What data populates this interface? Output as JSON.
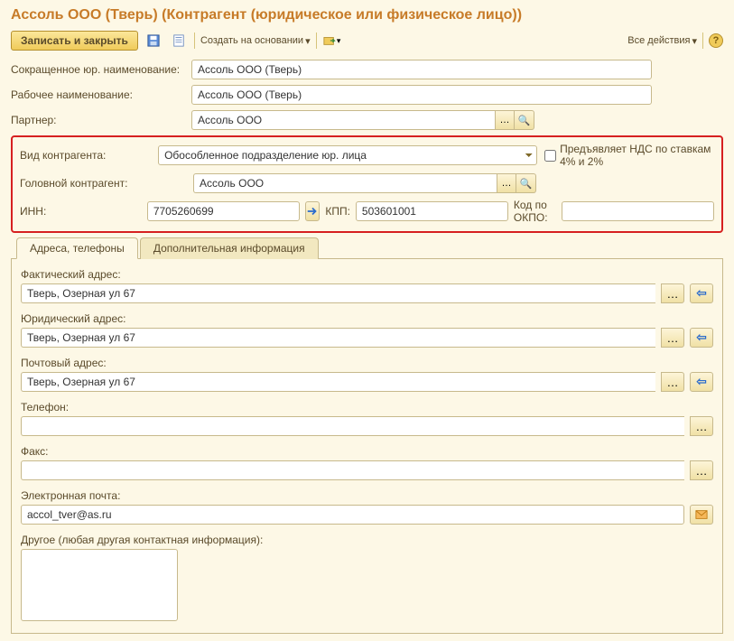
{
  "title": "Ассоль ООО (Тверь) (Контрагент (юридическое или физическое лицо))",
  "toolbar": {
    "save_close": "Записать и закрыть",
    "create_based": "Создать на основании",
    "all_actions": "Все действия"
  },
  "form": {
    "short_name_label": "Сокращенное юр. наименование:",
    "short_name": "Ассоль ООО (Тверь)",
    "work_name_label": "Рабочее наименование:",
    "work_name": "Ассоль ООО (Тверь)",
    "partner_label": "Партнер:",
    "partner": "Ассоль ООО",
    "type_label": "Вид контрагента:",
    "type": "Обособленное подразделение юр. лица",
    "vat_checkbox": "Предъявляет НДС по ставкам 4% и 2%",
    "head_label": "Головной контрагент:",
    "head": "Ассоль ООО",
    "inn_label": "ИНН:",
    "inn": "7705260699",
    "kpp_label": "КПП:",
    "kpp": "503601001",
    "okpo_label": "Код по ОКПО:",
    "okpo": ""
  },
  "tabs": {
    "addresses": "Адреса, телефоны",
    "additional": "Дополнительная информация"
  },
  "addresses": {
    "actual_label": "Фактический адрес:",
    "actual": "Тверь, Озерная ул 67",
    "legal_label": "Юридический адрес:",
    "legal": "Тверь, Озерная ул 67",
    "postal_label": "Почтовый адрес:",
    "postal": "Тверь, Озерная ул 67",
    "phone_label": "Телефон:",
    "phone": "",
    "fax_label": "Факс:",
    "fax": "",
    "email_label": "Электронная почта:",
    "email": "accol_tver@as.ru",
    "other_label": "Другое (любая другая контактная информация):",
    "other": ""
  }
}
